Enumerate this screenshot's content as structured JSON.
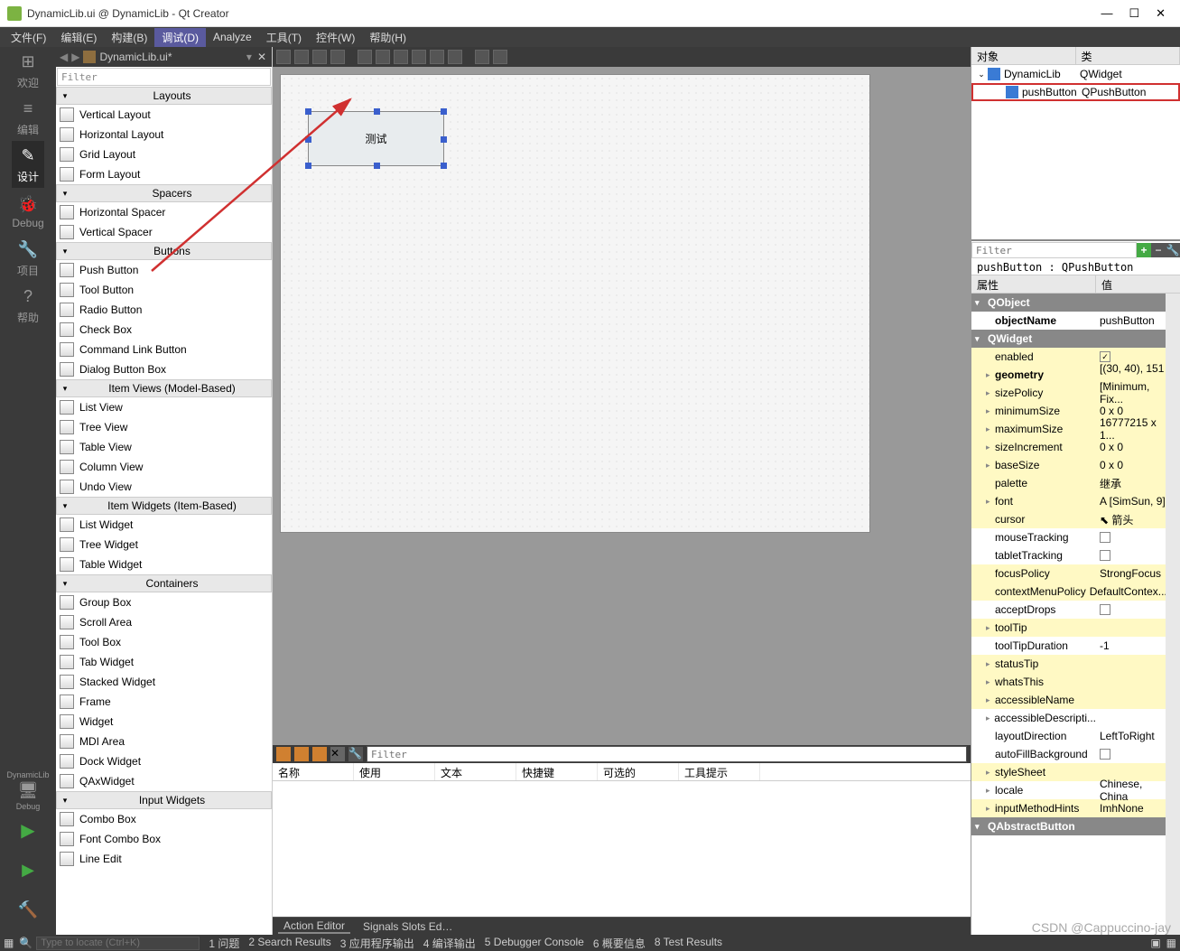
{
  "window": {
    "title": "DynamicLib.ui @ DynamicLib - Qt Creator"
  },
  "menu": {
    "items": [
      "文件(F)",
      "编辑(E)",
      "构建(B)",
      "调试(D)",
      "Analyze",
      "工具(T)",
      "控件(W)",
      "帮助(H)"
    ],
    "active_index": 3
  },
  "left_rail": {
    "items": [
      {
        "label": "欢迎",
        "icon": "⊞"
      },
      {
        "label": "编辑",
        "icon": "≡"
      },
      {
        "label": "设计",
        "icon": "✎",
        "active": true
      },
      {
        "label": "Debug",
        "icon": "🐞"
      },
      {
        "label": "项目",
        "icon": "🔧"
      },
      {
        "label": "帮助",
        "icon": "?"
      }
    ],
    "bottom": [
      {
        "label": "DynamicLib",
        "sub": "",
        "icon": "🖥"
      },
      {
        "label": "Debug",
        "sub": "",
        "icon": "🖥"
      }
    ]
  },
  "file_tab": {
    "name": "DynamicLib.ui*"
  },
  "widget_box": {
    "filter_placeholder": "Filter",
    "groups": [
      {
        "title": "Layouts",
        "items": [
          "Vertical Layout",
          "Horizontal Layout",
          "Grid Layout",
          "Form Layout"
        ]
      },
      {
        "title": "Spacers",
        "items": [
          "Horizontal Spacer",
          "Vertical Spacer"
        ]
      },
      {
        "title": "Buttons",
        "items": [
          "Push Button",
          "Tool Button",
          "Radio Button",
          "Check Box",
          "Command Link Button",
          "Dialog Button Box"
        ]
      },
      {
        "title": "Item Views (Model-Based)",
        "items": [
          "List View",
          "Tree View",
          "Table View",
          "Column View",
          "Undo View"
        ]
      },
      {
        "title": "Item Widgets (Item-Based)",
        "items": [
          "List Widget",
          "Tree Widget",
          "Table Widget"
        ]
      },
      {
        "title": "Containers",
        "items": [
          "Group Box",
          "Scroll Area",
          "Tool Box",
          "Tab Widget",
          "Stacked Widget",
          "Frame",
          "Widget",
          "MDI Area",
          "Dock Widget",
          "QAxWidget"
        ]
      },
      {
        "title": "Input Widgets",
        "items": [
          "Combo Box",
          "Font Combo Box",
          "Line Edit"
        ]
      }
    ]
  },
  "canvas": {
    "button_text": "测试"
  },
  "action_editor": {
    "filter_placeholder": "Filter",
    "columns": [
      "名称",
      "使用",
      "文本",
      "快捷键",
      "可选的",
      "工具提示"
    ],
    "tabs": [
      "Action Editor",
      "Signals Slots Ed…"
    ]
  },
  "object_inspector": {
    "columns": [
      "对象",
      "类"
    ],
    "rows": [
      {
        "name": "DynamicLib",
        "class": "QWidget",
        "level": 0
      },
      {
        "name": "pushButton",
        "class": "QPushButton",
        "level": 1,
        "highlight": true
      }
    ]
  },
  "property_editor": {
    "filter_placeholder": "Filter",
    "title": "pushButton : QPushButton",
    "columns": [
      "属性",
      "值"
    ],
    "groups": [
      {
        "name": "QObject",
        "props": [
          {
            "name": "objectName",
            "value": "pushButton",
            "bold": true
          }
        ]
      },
      {
        "name": "QWidget",
        "props": [
          {
            "name": "enabled",
            "value": "check:true",
            "yellow": true
          },
          {
            "name": "geometry",
            "value": "[(30, 40), 151 ...",
            "yellow": true,
            "expandable": true,
            "bold": true
          },
          {
            "name": "sizePolicy",
            "value": "[Minimum, Fix...",
            "yellow": true,
            "expandable": true
          },
          {
            "name": "minimumSize",
            "value": "0 x 0",
            "yellow": true,
            "expandable": true
          },
          {
            "name": "maximumSize",
            "value": "16777215 x 1...",
            "yellow": true,
            "expandable": true
          },
          {
            "name": "sizeIncrement",
            "value": "0 x 0",
            "yellow": true,
            "expandable": true
          },
          {
            "name": "baseSize",
            "value": "0 x 0",
            "yellow": true,
            "expandable": true
          },
          {
            "name": "palette",
            "value": "继承",
            "yellow": true
          },
          {
            "name": "font",
            "value": "A  [SimSun, 9]",
            "yellow": true,
            "expandable": true
          },
          {
            "name": "cursor",
            "value": "⬉ 箭头",
            "yellow": true
          },
          {
            "name": "mouseTracking",
            "value": "check:false"
          },
          {
            "name": "tabletTracking",
            "value": "check:false"
          },
          {
            "name": "focusPolicy",
            "value": "StrongFocus",
            "yellow": true
          },
          {
            "name": "contextMenuPolicy",
            "value": "DefaultContex...",
            "yellow": true
          },
          {
            "name": "acceptDrops",
            "value": "check:false"
          },
          {
            "name": "toolTip",
            "value": "",
            "yellow": true,
            "expandable": true
          },
          {
            "name": "toolTipDuration",
            "value": "-1"
          },
          {
            "name": "statusTip",
            "value": "",
            "yellow": true,
            "expandable": true
          },
          {
            "name": "whatsThis",
            "value": "",
            "yellow": true,
            "expandable": true
          },
          {
            "name": "accessibleName",
            "value": "",
            "yellow": true,
            "expandable": true
          },
          {
            "name": "accessibleDescripti...",
            "value": "",
            "expandable": true
          },
          {
            "name": "layoutDirection",
            "value": "LeftToRight"
          },
          {
            "name": "autoFillBackground",
            "value": "check:false"
          },
          {
            "name": "styleSheet",
            "value": "",
            "yellow": true,
            "expandable": true
          },
          {
            "name": "locale",
            "value": "Chinese, China",
            "expandable": true
          },
          {
            "name": "inputMethodHints",
            "value": "ImhNone",
            "yellow": true,
            "expandable": true
          }
        ]
      },
      {
        "name": "QAbstractButton",
        "props": []
      }
    ]
  },
  "statusbar": {
    "locator_placeholder": "Type to locate (Ctrl+K)",
    "tabs": [
      "1 问题",
      "2 Search Results",
      "3 应用程序输出",
      "4 编译输出",
      "5 Debugger Console",
      "6 概要信息",
      "8 Test Results"
    ]
  },
  "watermark": "CSDN @Cappuccino-jay"
}
